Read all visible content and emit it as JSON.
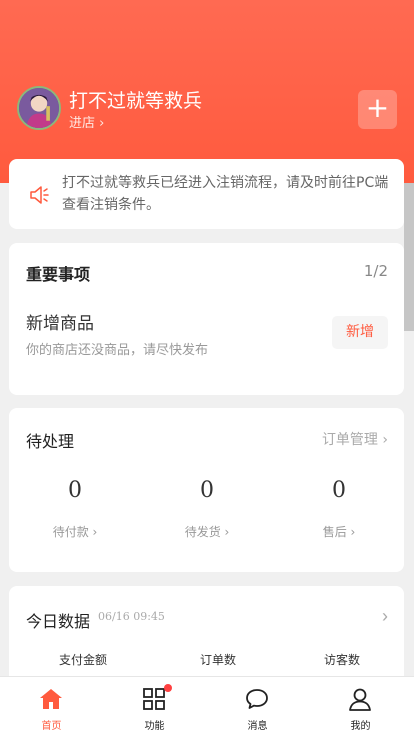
{
  "header": {
    "shop_name": "打不过就等救兵",
    "enter_label": "进店 ›",
    "plus_label": "+"
  },
  "notice": {
    "text": "打不过就等救兵已经进入注销流程，请及时前往PC端查看注销条件。",
    "icon": "speaker-icon"
  },
  "important": {
    "title": "重要事项",
    "page": "1/2",
    "item_title": "新增商品",
    "item_desc": "你的商店还没商品，请尽快发布",
    "action_label": "新增"
  },
  "pending": {
    "title": "待处理",
    "link_label": "订单管理 ›",
    "items": [
      {
        "count": "0",
        "label": "待付款 ›"
      },
      {
        "count": "0",
        "label": "待发货 ›"
      },
      {
        "count": "0",
        "label": "售后 ›"
      }
    ]
  },
  "today": {
    "title": "今日数据",
    "time": "06/16 09:45",
    "arrow": "›",
    "metrics": [
      "支付金额",
      "订单数",
      "访客数"
    ]
  },
  "tabbar": {
    "items": [
      {
        "label": "首页",
        "icon": "home-icon",
        "active": true
      },
      {
        "label": "功能",
        "icon": "grid-icon",
        "active": false
      },
      {
        "label": "消息",
        "icon": "chat-icon",
        "active": false
      },
      {
        "label": "我的",
        "icon": "user-icon",
        "active": false
      }
    ]
  },
  "colors": {
    "accent": "#ff5a3e",
    "badge": "#ff4040"
  }
}
